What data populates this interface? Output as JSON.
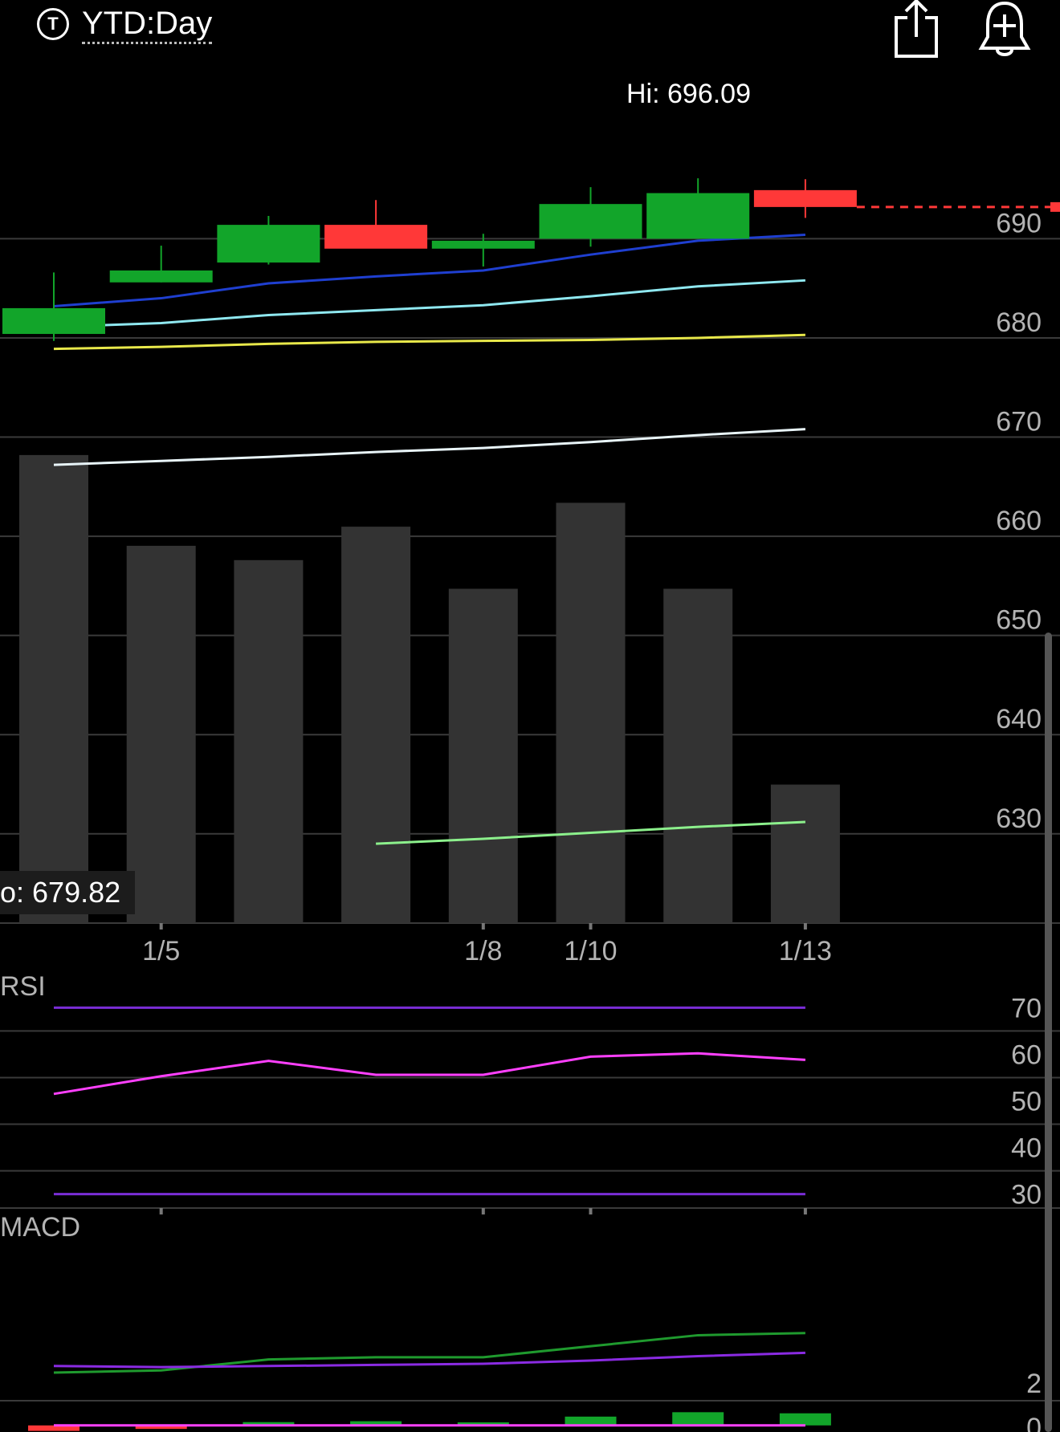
{
  "header": {
    "title": "YTD:Day",
    "ticker_icon_letter": "T",
    "share_icon": "share-icon",
    "alert_icon": "add-alert-bell-icon"
  },
  "chart_data": [
    {
      "type": "candlestick",
      "title": "",
      "hi_label": "Hi: 696.09",
      "hover_label": "o: 679.82",
      "last_price_line": 693.2,
      "ylim": [
        621,
        708
      ],
      "y_ticks": [
        690,
        680,
        670,
        660,
        650,
        640,
        630
      ],
      "x_tick_labels": [
        {
          "index": 1,
          "label": "1/5"
        },
        {
          "index": 4,
          "label": "1/8"
        },
        {
          "index": 5,
          "label": "1/10"
        },
        {
          "index": 7,
          "label": "1/13"
        }
      ],
      "candles": [
        {
          "open": 680.4,
          "high": 686.6,
          "low": 679.7,
          "close": 683.0
        },
        {
          "open": 685.6,
          "high": 689.3,
          "low": 685.6,
          "close": 686.8
        },
        {
          "open": 687.6,
          "high": 692.3,
          "low": 687.4,
          "close": 691.4
        },
        {
          "open": 691.4,
          "high": 693.9,
          "low": 689.2,
          "close": 689.0
        },
        {
          "open": 689.0,
          "high": 690.5,
          "low": 687.2,
          "close": 689.8
        },
        {
          "open": 690.0,
          "high": 695.2,
          "low": 689.2,
          "close": 693.5
        },
        {
          "open": 690.0,
          "high": 696.09,
          "low": 690.0,
          "close": 694.6
        },
        {
          "open": 694.9,
          "high": 696.0,
          "low": 692.1,
          "close": 693.2
        }
      ],
      "moving_averages": [
        {
          "color": "#1f3fd0",
          "points": [
            [
              0,
              683.2
            ],
            [
              1,
              684.0
            ],
            [
              2,
              685.5
            ],
            [
              3,
              686.2
            ],
            [
              4,
              686.8
            ],
            [
              5,
              688.4
            ],
            [
              6,
              689.8
            ],
            [
              7,
              690.4
            ]
          ]
        },
        {
          "color": "#8fe8f0",
          "points": [
            [
              0,
              681.1
            ],
            [
              1,
              681.5
            ],
            [
              2,
              682.3
            ],
            [
              3,
              682.8
            ],
            [
              4,
              683.3
            ],
            [
              5,
              684.2
            ],
            [
              6,
              685.2
            ],
            [
              7,
              685.8
            ]
          ]
        },
        {
          "color": "#e8e84a",
          "points": [
            [
              0,
              678.9
            ],
            [
              1,
              679.1
            ],
            [
              2,
              679.4
            ],
            [
              3,
              679.6
            ],
            [
              4,
              679.7
            ],
            [
              5,
              679.8
            ],
            [
              6,
              680.0
            ],
            [
              7,
              680.3
            ]
          ]
        },
        {
          "color": "#e8f4f8",
          "points": [
            [
              0,
              667.2
            ],
            [
              1,
              667.6
            ],
            [
              2,
              668.0
            ],
            [
              3,
              668.5
            ],
            [
              4,
              668.9
            ],
            [
              5,
              669.5
            ],
            [
              6,
              670.2
            ],
            [
              7,
              670.8
            ]
          ]
        },
        {
          "color": "#8cf08c",
          "points": [
            [
              3,
              629.0
            ],
            [
              4,
              629.5
            ],
            [
              5,
              630.1
            ],
            [
              6,
              630.7
            ],
            [
              7,
              631.2
            ]
          ]
        }
      ],
      "volume": [
        0.98,
        0.79,
        0.76,
        0.83,
        0.7,
        0.88,
        0.7,
        0.29
      ],
      "colors": {
        "up": "#12a52a",
        "down": "#ff3838",
        "volume": "#333333",
        "grid": "#3a3a3a",
        "axis_text": "#b3b3b3"
      }
    },
    {
      "type": "line",
      "title": "RSI",
      "ylim": [
        27,
        73
      ],
      "y_ticks": [
        70,
        60,
        50,
        40,
        30
      ],
      "reference_lines": [
        70,
        30
      ],
      "series": [
        {
          "color": "#ff40ff",
          "values": [
            51.5,
            55.3,
            58.6,
            55.6,
            55.6,
            59.5,
            60.2,
            58.8
          ]
        }
      ],
      "colors": {
        "reference": "#7a2dd6"
      }
    },
    {
      "type": "bar+line",
      "title": "MACD",
      "ylim": [
        -0.3,
        9.7
      ],
      "y_ticks": [
        2,
        0
      ],
      "series": [
        {
          "color": "#1f9a2e",
          "values": [
            2.4,
            2.5,
            3.0,
            3.1,
            3.1,
            3.6,
            4.1,
            4.2
          ]
        },
        {
          "color": "#8a2be2",
          "values": [
            2.7,
            2.65,
            2.7,
            2.75,
            2.8,
            2.95,
            3.15,
            3.3
          ]
        }
      ],
      "histogram": [
        -0.25,
        -0.16,
        0.15,
        0.19,
        0.14,
        0.4,
        0.6,
        0.55
      ],
      "zero_line_color": "#ff40ff"
    }
  ]
}
